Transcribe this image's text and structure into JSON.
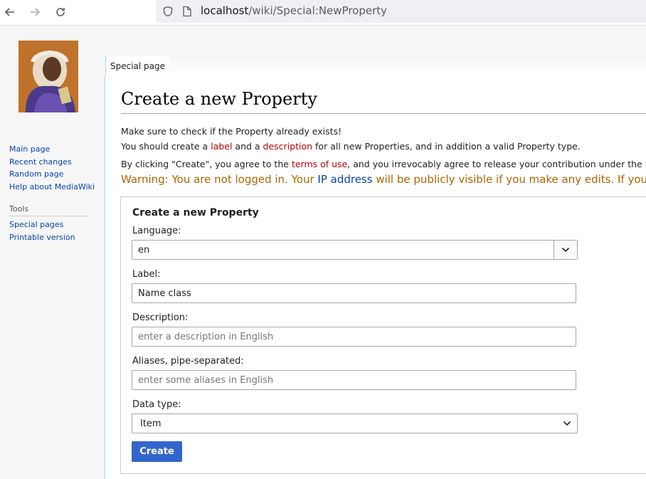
{
  "browser": {
    "url_host": "localhost",
    "url_path": "/wiki/Special:NewProperty"
  },
  "sidebar": {
    "nav": [
      "Main page",
      "Recent changes",
      "Random page",
      "Help about MediaWiki"
    ],
    "tools_heading": "Tools",
    "tools": [
      "Special pages",
      "Printable version"
    ]
  },
  "tab": {
    "label": "Special page"
  },
  "page": {
    "title": "Create a new Property",
    "intro1": "Make sure to check if the Property already exists!",
    "intro2_a": "You should create a ",
    "intro2_label": "label",
    "intro2_b": " and a ",
    "intro2_desc": "description",
    "intro2_c": " for all new Properties, and in addition a valid Property type.",
    "terms_a": "By clicking \"Create\", you agree to the ",
    "terms_link": "terms of use",
    "terms_b": ", and you irrevocably agree to release your contribution under the",
    "warning_a": "Warning: You are not logged in. Your ",
    "warning_link": "IP address",
    "warning_b": " will be publicly visible if you make any edits. If you"
  },
  "form": {
    "heading": "Create a new Property",
    "language_label": "Language:",
    "language_value": "en",
    "label_label": "Label:",
    "label_value": "Name class",
    "description_label": "Description:",
    "description_placeholder": "enter a description in English",
    "aliases_label": "Aliases, pipe-separated:",
    "aliases_placeholder": "enter some aliases in English",
    "datatype_label": "Data type:",
    "datatype_value": "Item",
    "submit_label": "Create"
  },
  "colors": {
    "link": "#0645ad",
    "redlink": "#ba0000",
    "warning": "#ac6600",
    "button": "#3366cc"
  }
}
